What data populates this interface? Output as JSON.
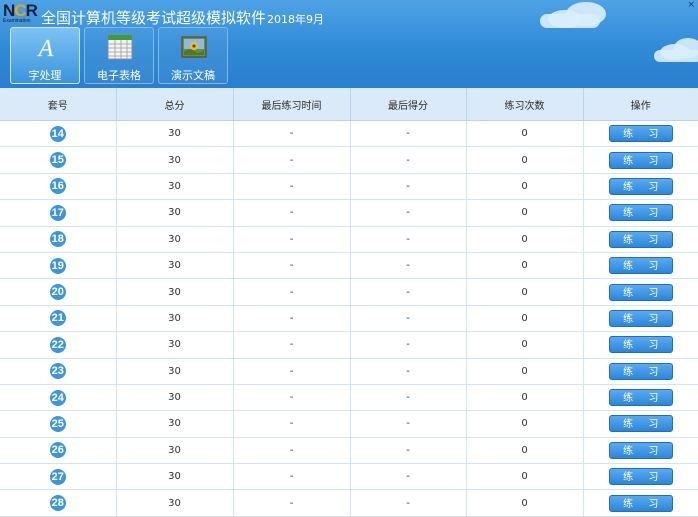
{
  "header": {
    "logo_text": "NCR",
    "logo_sub": "Examination",
    "title": "全国计算机等级考试超级模拟软件",
    "title_date": "2018年9月",
    "close_label": "×"
  },
  "toolbar": {
    "items": [
      {
        "label": "字处理",
        "icon": "word-processing-icon",
        "active": true
      },
      {
        "label": "电子表格",
        "icon": "spreadsheet-icon",
        "active": false
      },
      {
        "label": "演示文稿",
        "icon": "presentation-icon",
        "active": false
      }
    ]
  },
  "table": {
    "headers": [
      "套号",
      "总分",
      "最后练习时间",
      "最后得分",
      "练习次数",
      "操作"
    ],
    "action_label": "练 习",
    "rows": [
      {
        "id": "14",
        "score": "30",
        "last_time": "-",
        "last_score": "-",
        "count": "0"
      },
      {
        "id": "15",
        "score": "30",
        "last_time": "-",
        "last_score": "-",
        "count": "0"
      },
      {
        "id": "16",
        "score": "30",
        "last_time": "-",
        "last_score": "-",
        "count": "0"
      },
      {
        "id": "17",
        "score": "30",
        "last_time": "-",
        "last_score": "-",
        "count": "0"
      },
      {
        "id": "18",
        "score": "30",
        "last_time": "-",
        "last_score": "-",
        "count": "0"
      },
      {
        "id": "19",
        "score": "30",
        "last_time": "-",
        "last_score": "-",
        "count": "0"
      },
      {
        "id": "20",
        "score": "30",
        "last_time": "-",
        "last_score": "-",
        "count": "0"
      },
      {
        "id": "21",
        "score": "30",
        "last_time": "-",
        "last_score": "-",
        "count": "0"
      },
      {
        "id": "22",
        "score": "30",
        "last_time": "-",
        "last_score": "-",
        "count": "0"
      },
      {
        "id": "23",
        "score": "30",
        "last_time": "-",
        "last_score": "-",
        "count": "0"
      },
      {
        "id": "24",
        "score": "30",
        "last_time": "-",
        "last_score": "-",
        "count": "0"
      },
      {
        "id": "25",
        "score": "30",
        "last_time": "-",
        "last_score": "-",
        "count": "0"
      },
      {
        "id": "26",
        "score": "30",
        "last_time": "-",
        "last_score": "-",
        "count": "0"
      },
      {
        "id": "27",
        "score": "30",
        "last_time": "-",
        "last_score": "-",
        "count": "0"
      },
      {
        "id": "28",
        "score": "30",
        "last_time": "-",
        "last_score": "-",
        "count": "0"
      }
    ]
  }
}
